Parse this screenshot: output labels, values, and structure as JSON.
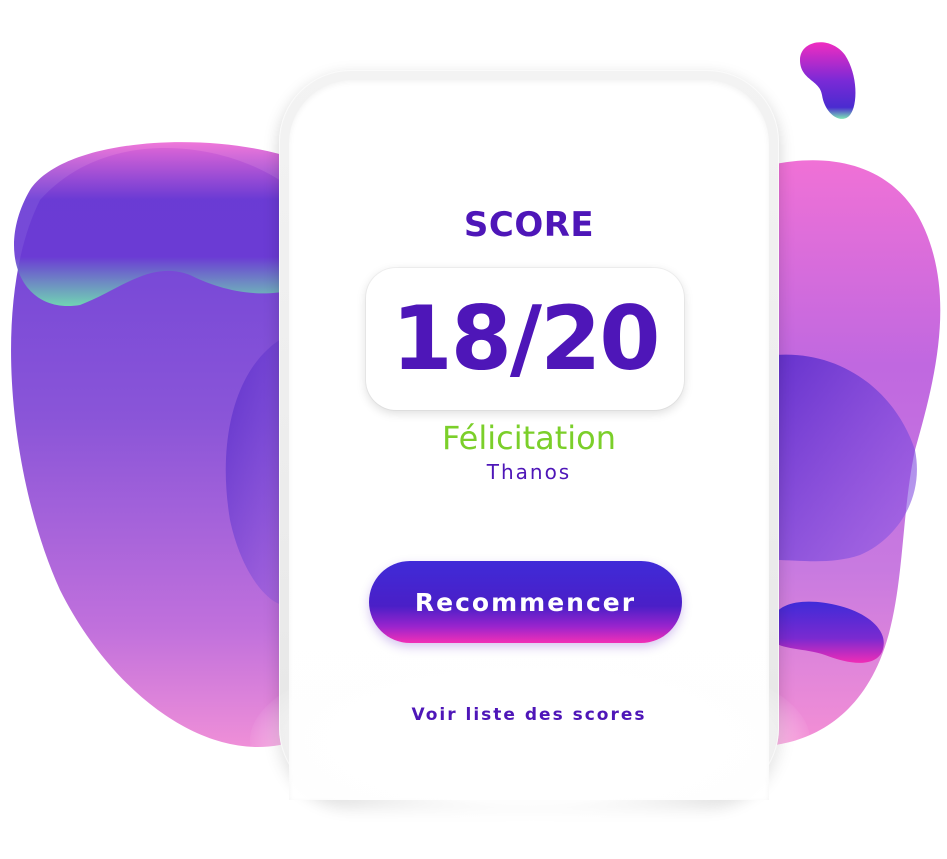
{
  "score": {
    "title": "SCORE",
    "value": "18/20",
    "message": "Félicitation",
    "player": "Thanos"
  },
  "actions": {
    "restart_label": "Recommencer",
    "scores_link_label": "Voir liste des scores"
  },
  "colors": {
    "primary": "#4e16b8",
    "success": "#7bcf2a",
    "accent_pink": "#f22fb6",
    "accent_blue": "#3f2bd8"
  }
}
